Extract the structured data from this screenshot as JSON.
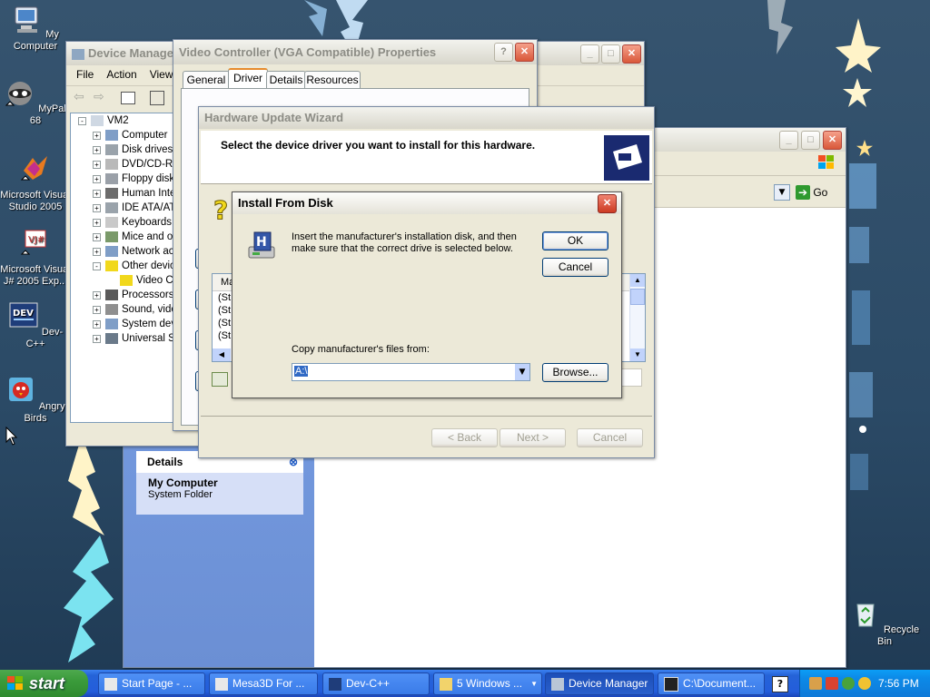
{
  "desktop": {
    "icons": [
      {
        "label": "My Computer"
      },
      {
        "label": "MyPal 68"
      },
      {
        "label": "Microsoft Visual Studio 2005"
      },
      {
        "label": "Microsoft Visual J# 2005 Exp..."
      },
      {
        "label": "Dev-C++"
      },
      {
        "label": "Angry Birds"
      },
      {
        "label": "Recycle Bin"
      }
    ]
  },
  "device_manager": {
    "title": "Device Manager",
    "menu": [
      "File",
      "Action",
      "View"
    ],
    "tree": [
      {
        "label": "VM2",
        "level": 0,
        "expander": "-"
      },
      {
        "label": "Computer",
        "level": 1,
        "expander": "+"
      },
      {
        "label": "Disk drives",
        "level": 1,
        "expander": "+"
      },
      {
        "label": "DVD/CD-RO",
        "level": 1,
        "expander": "+"
      },
      {
        "label": "Floppy disk",
        "level": 1,
        "expander": "+"
      },
      {
        "label": "Human Inte",
        "level": 1,
        "expander": "+"
      },
      {
        "label": "IDE ATA/AT",
        "level": 1,
        "expander": "+"
      },
      {
        "label": "Keyboards",
        "level": 1,
        "expander": "+"
      },
      {
        "label": "Mice and ot",
        "level": 1,
        "expander": "+"
      },
      {
        "label": "Network ac",
        "level": 1,
        "expander": "+"
      },
      {
        "label": "Other devic",
        "level": 1,
        "expander": "-"
      },
      {
        "label": "Video C",
        "level": 2,
        "expander": ""
      },
      {
        "label": "Processors",
        "level": 1,
        "expander": "+"
      },
      {
        "label": "Sound, vide",
        "level": 1,
        "expander": "+"
      },
      {
        "label": "System dev",
        "level": 1,
        "expander": "+"
      },
      {
        "label": "Universal S",
        "level": 1,
        "expander": "+"
      }
    ]
  },
  "explorer": {
    "go_label": "Go",
    "details_title": "Details",
    "details_name": "My Computer",
    "details_type": "System Folder"
  },
  "properties": {
    "title": "Video Controller (VGA Compatible) Properties",
    "tabs": [
      "General",
      "Driver",
      "Details",
      "Resources"
    ],
    "active_tab": "Driver"
  },
  "wizard": {
    "title": "Hardware Update Wizard",
    "heading": "Select the device driver you want to install for this hardware.",
    "list_header": "Ma",
    "list_rows": [
      "(St",
      "(St",
      "(St",
      "(St"
    ],
    "back_label": "< Back",
    "next_label": "Next >",
    "cancel_label": "Cancel"
  },
  "install_dialog": {
    "title": "Install From Disk",
    "message": "Insert the manufacturer's installation disk, and then make sure that the correct drive is selected below.",
    "ok_label": "OK",
    "cancel_label": "Cancel",
    "copy_label": "Copy manufacturer's files from:",
    "path_value": "A:\\",
    "browse_label": "Browse..."
  },
  "taskbar": {
    "start_label": "start",
    "tasks": [
      {
        "label": "Start Page - ..."
      },
      {
        "label": "Mesa3D For ..."
      },
      {
        "label": "Dev-C++"
      },
      {
        "label": "5 Windows ..."
      },
      {
        "label": "Device Manager"
      },
      {
        "label": "C:\\Document..."
      }
    ],
    "clock": "7:56 PM"
  }
}
